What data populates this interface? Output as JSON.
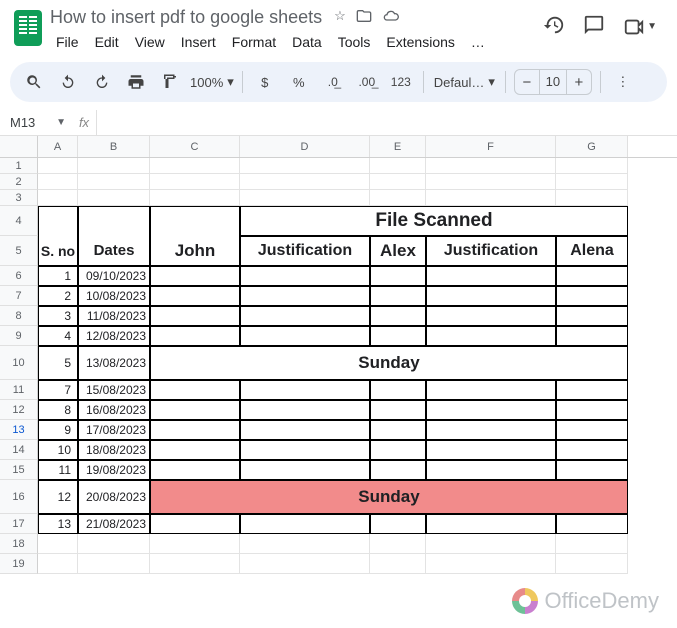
{
  "doc_title": "How to insert pdf to google sheets",
  "menus": [
    "File",
    "Edit",
    "View",
    "Insert",
    "Format",
    "Data",
    "Tools",
    "Extensions",
    "…"
  ],
  "toolbar": {
    "zoom": "100%",
    "font": "Defaul…",
    "font_size": "10"
  },
  "namebox": "M13",
  "columns": [
    "A",
    "B",
    "C",
    "D",
    "E",
    "F",
    "G"
  ],
  "row_heights": {
    "r1": 16,
    "r2": 16,
    "r3": 16,
    "r4": 30,
    "r5": 30,
    "r6": 20,
    "r7": 20,
    "r8": 20,
    "r9": 20,
    "r10": 34,
    "r11": 20,
    "r12": 20,
    "r13": 20,
    "r14": 20,
    "r15": 20,
    "r16": 34,
    "r17": 20,
    "r18": 20,
    "r19": 20
  },
  "selected_row": 13,
  "chart_data": {
    "type": "table",
    "merged_header": "File Scanned",
    "columns": [
      "S. no",
      "Dates",
      "John",
      "Justification",
      "Alex",
      "Justification",
      "Alena"
    ],
    "rows": [
      {
        "sno": 1,
        "date": "09/10/2023"
      },
      {
        "sno": 2,
        "date": "10/08/2023"
      },
      {
        "sno": 3,
        "date": "11/08/2023"
      },
      {
        "sno": 4,
        "date": "12/08/2023"
      },
      {
        "sno": 5,
        "date": "13/08/2023",
        "merged_note": "Sunday"
      },
      {
        "sno": 7,
        "date": "15/08/2023"
      },
      {
        "sno": 8,
        "date": "16/08/2023"
      },
      {
        "sno": 9,
        "date": "17/08/2023"
      },
      {
        "sno": 10,
        "date": "18/08/2023"
      },
      {
        "sno": 11,
        "date": "19/08/2023"
      },
      {
        "sno": 12,
        "date": "20/08/2023",
        "merged_note": "Sunday",
        "highlight": "pink"
      },
      {
        "sno": 13,
        "date": "21/08/2023"
      }
    ]
  },
  "watermark": "OfficeDemy"
}
